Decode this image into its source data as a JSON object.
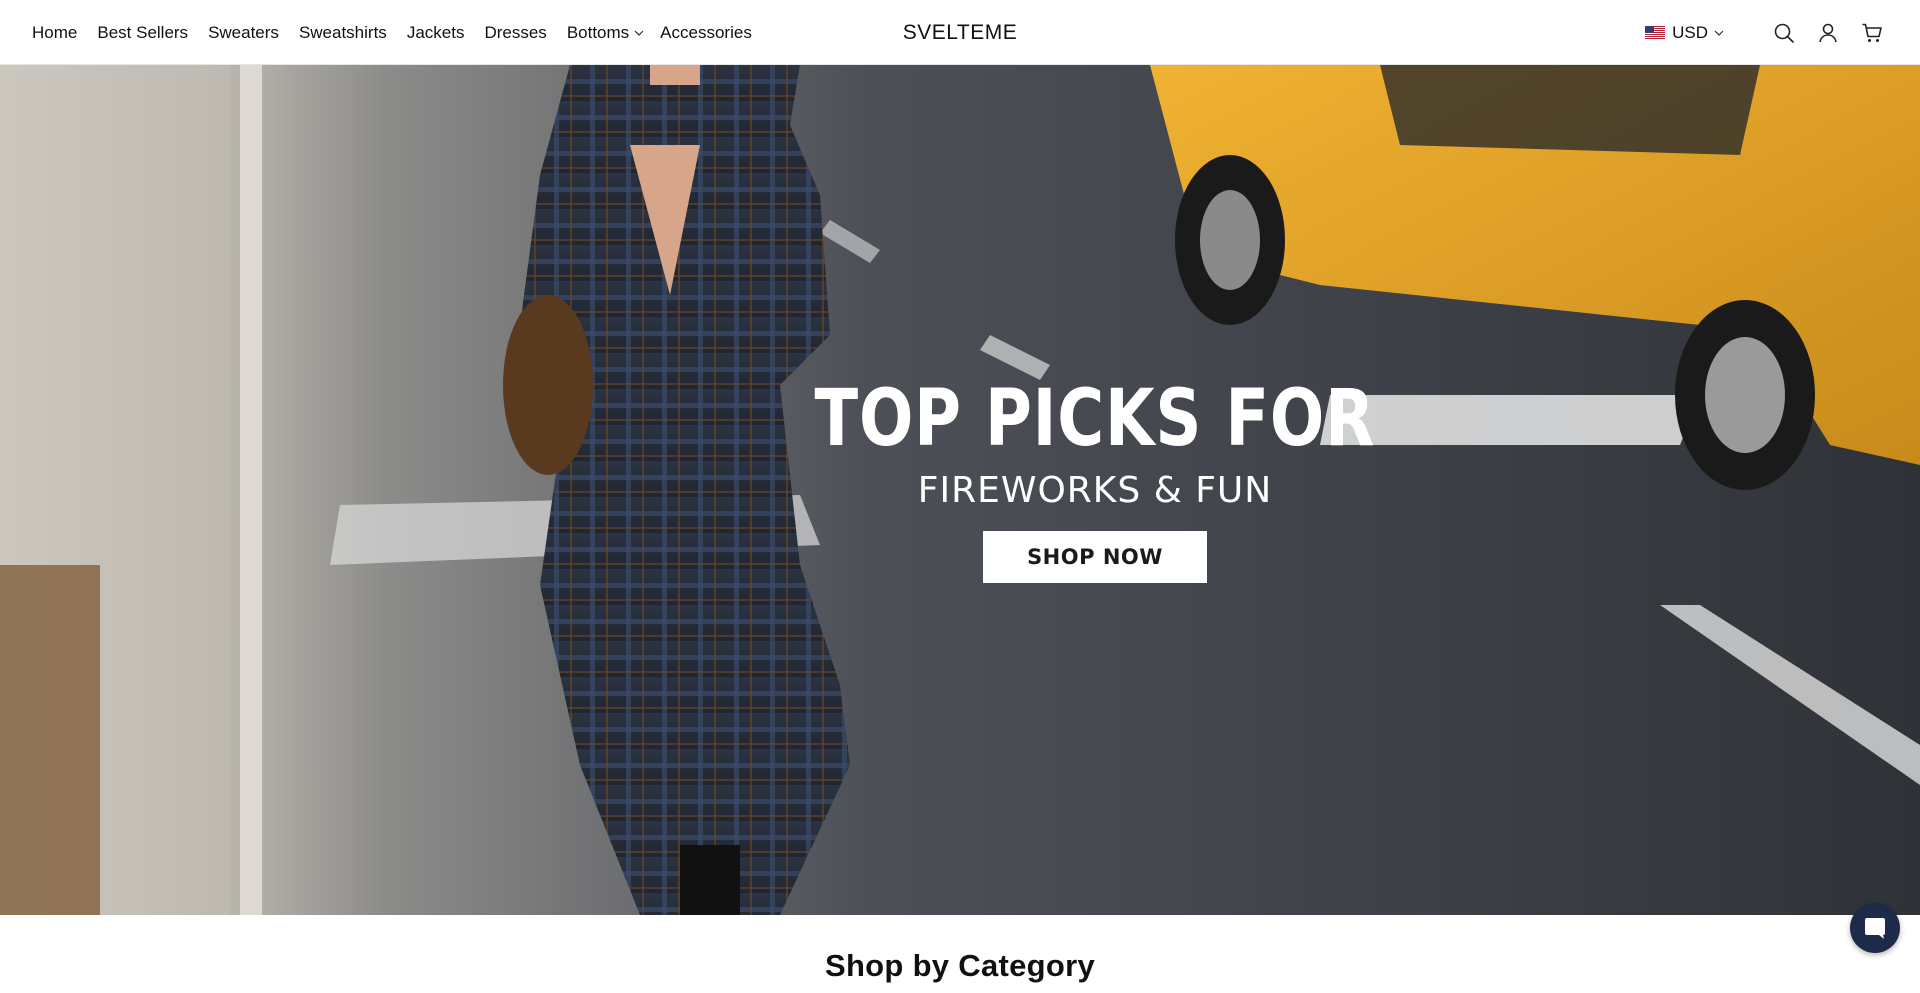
{
  "nav": {
    "items": [
      {
        "label": "Home"
      },
      {
        "label": "Best Sellers"
      },
      {
        "label": "Sweaters"
      },
      {
        "label": "Sweatshirts"
      },
      {
        "label": "Jackets"
      },
      {
        "label": "Dresses"
      },
      {
        "label": "Bottoms",
        "has_dropdown": true
      },
      {
        "label": "Accessories"
      }
    ]
  },
  "brand": {
    "name": "SVELTEME"
  },
  "tools": {
    "currency": "USD",
    "currency_flag": "us-flag-icon",
    "icons": [
      "search-icon",
      "account-icon",
      "cart-icon"
    ]
  },
  "hero": {
    "title": "TOP PICKS FOR",
    "subtitle": "FIREWORKS & FUN",
    "cta_label": "SHOP NOW"
  },
  "section": {
    "title": "Shop by Category"
  },
  "chat": {
    "icon": "chat-icon",
    "color": "#1e2a4a"
  }
}
